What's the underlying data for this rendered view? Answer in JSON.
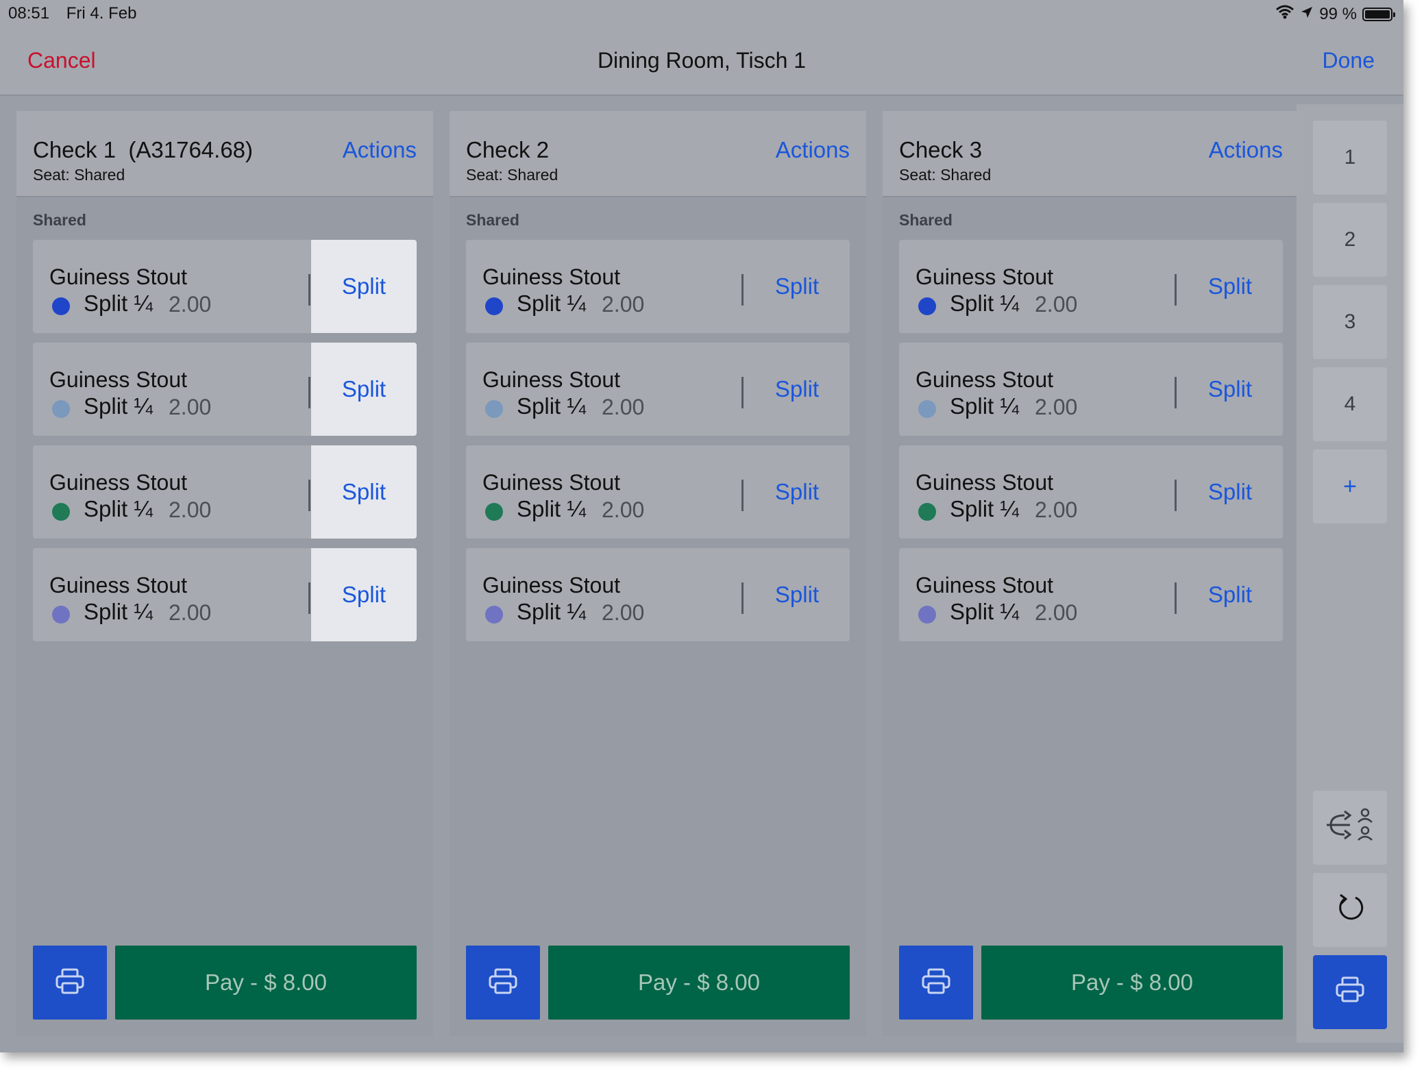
{
  "status_bar": {
    "time": "08:51",
    "date": "Fri 4. Feb",
    "battery": "99 %",
    "icons": [
      "wifi-icon",
      "location-arrow-icon",
      "battery-icon"
    ]
  },
  "nav": {
    "cancel": "Cancel",
    "title": "Dining Room, Tisch 1",
    "done": "Done"
  },
  "checks": [
    {
      "title": "Check 1  (A31764.68)",
      "seat": "Seat: Shared",
      "actions": "Actions",
      "section": "Shared",
      "items": [
        {
          "name": "Guiness Stout",
          "split": "Split ¼",
          "price": "2.00",
          "color": "#1f45c9",
          "button": "Split"
        },
        {
          "name": "Guiness Stout",
          "split": "Split ¼",
          "price": "2.00",
          "color": "#7b98bd",
          "button": "Split"
        },
        {
          "name": "Guiness Stout",
          "split": "Split ¼",
          "price": "2.00",
          "color": "#1f7a55",
          "button": "Split"
        },
        {
          "name": "Guiness Stout",
          "split": "Split ¼",
          "price": "2.00",
          "color": "#6f73c2",
          "button": "Split"
        }
      ],
      "pay": "Pay - $ 8.00"
    },
    {
      "title": "Check 2",
      "seat": "Seat: Shared",
      "actions": "Actions",
      "section": "Shared",
      "items": [
        {
          "name": "Guiness Stout",
          "split": "Split ¼",
          "price": "2.00",
          "color": "#1f45c9",
          "button": "Split"
        },
        {
          "name": "Guiness Stout",
          "split": "Split ¼",
          "price": "2.00",
          "color": "#7b98bd",
          "button": "Split"
        },
        {
          "name": "Guiness Stout",
          "split": "Split ¼",
          "price": "2.00",
          "color": "#1f7a55",
          "button": "Split"
        },
        {
          "name": "Guiness Stout",
          "split": "Split ¼",
          "price": "2.00",
          "color": "#6f73c2",
          "button": "Split"
        }
      ],
      "pay": "Pay - $ 8.00"
    },
    {
      "title": "Check 3",
      "seat": "Seat: Shared",
      "actions": "Actions",
      "section": "Shared",
      "items": [
        {
          "name": "Guiness Stout",
          "split": "Split ¼",
          "price": "2.00",
          "color": "#1f45c9",
          "button": "Split"
        },
        {
          "name": "Guiness Stout",
          "split": "Split ¼",
          "price": "2.00",
          "color": "#7b98bd",
          "button": "Split"
        },
        {
          "name": "Guiness Stout",
          "split": "Split ¼",
          "price": "2.00",
          "color": "#1f7a55",
          "button": "Split"
        },
        {
          "name": "Guiness Stout",
          "split": "Split ¼",
          "price": "2.00",
          "color": "#6f73c2",
          "button": "Split"
        }
      ],
      "pay": "Pay - $ 8.00"
    }
  ],
  "sidebar": {
    "seats": [
      "1",
      "2",
      "3",
      "4"
    ],
    "add": "+",
    "tools": [
      "move-guests-icon",
      "undo-icon",
      "printer-icon"
    ]
  },
  "colors": {
    "accent": "#1a56db",
    "cancel": "#c8102e",
    "pay": "#006446",
    "print": "#1e4fc8"
  }
}
